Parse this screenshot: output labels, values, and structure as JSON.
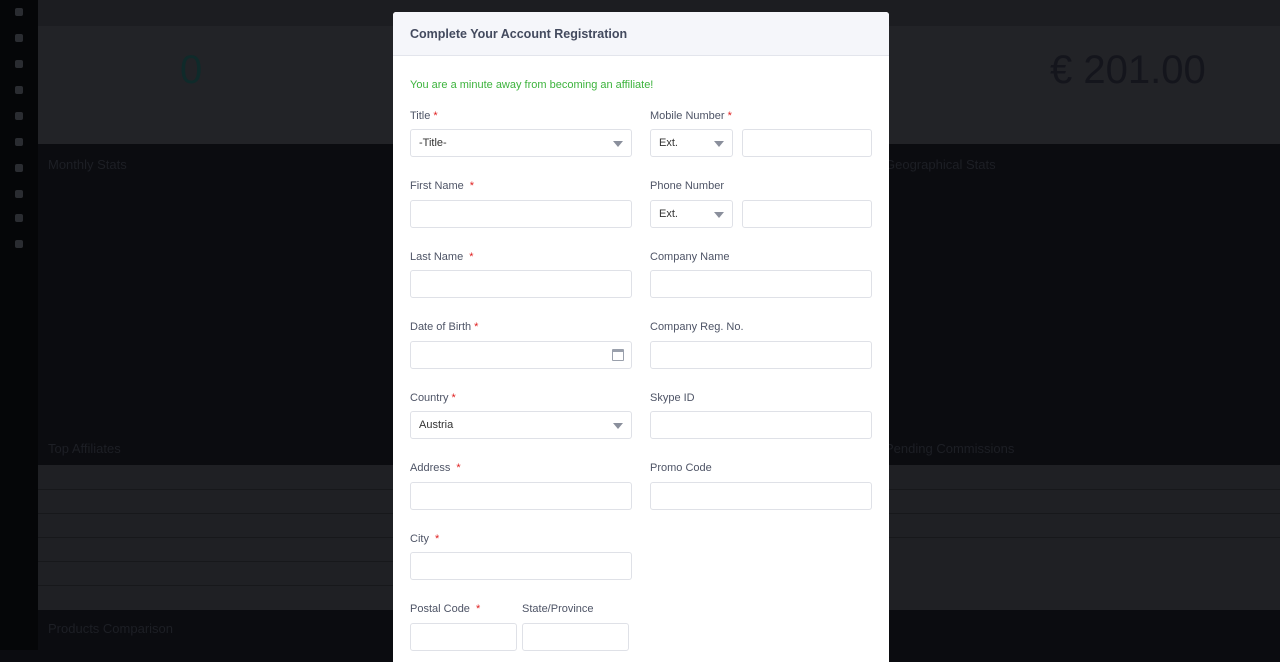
{
  "background": {
    "stats": {
      "affiliates_count": "0",
      "commission_total": "€ 201.00"
    },
    "panels": [
      "Monthly Stats",
      "Geographical Stats",
      "Top Affiliates",
      "Pending Commissions",
      "Products Comparison"
    ]
  },
  "modal": {
    "title": "Complete Your Account Registration",
    "intro": "You are a minute away from becoming an affiliate!",
    "required_mark": "*",
    "fields": {
      "title": {
        "label": "Title",
        "value": "-Title-"
      },
      "mobile": {
        "label": "Mobile Number",
        "ext": "Ext.",
        "value": ""
      },
      "first_name": {
        "label": "First Name"
      },
      "phone": {
        "label": "Phone Number",
        "ext": "Ext.",
        "value": ""
      },
      "last_name": {
        "label": "Last Name"
      },
      "company_name": {
        "label": "Company Name"
      },
      "dob": {
        "label": "Date of Birth"
      },
      "company_reg": {
        "label": "Company Reg. No."
      },
      "country": {
        "label": "Country",
        "value": "Austria"
      },
      "skype": {
        "label": "Skype ID"
      },
      "address": {
        "label": "Address"
      },
      "promo": {
        "label": "Promo Code"
      },
      "city": {
        "label": "City"
      },
      "postal": {
        "label": "Postal Code"
      },
      "state": {
        "label": "State/Province"
      }
    }
  },
  "colors": {
    "accent_green": "#3db33d",
    "required_red": "#e02020",
    "overlay": "#0b0c10"
  }
}
